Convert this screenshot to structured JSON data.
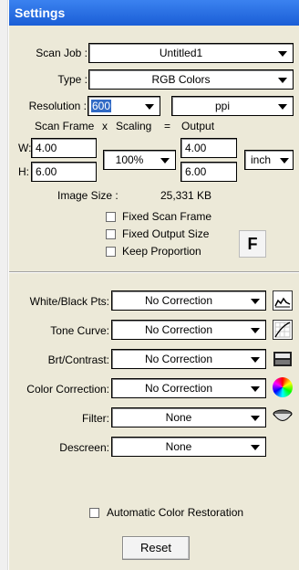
{
  "window": {
    "title": "Settings"
  },
  "scan_job": {
    "label": "Scan Job :",
    "value": "Untitled1"
  },
  "type": {
    "label": "Type :",
    "value": "RGB Colors"
  },
  "resolution": {
    "label": "Resolution :",
    "value": "600",
    "unit": "ppi"
  },
  "frame": {
    "h_scan": "Scan Frame",
    "h_x": "x",
    "h_scaling": "Scaling",
    "h_eq": "=",
    "h_output": "Output",
    "w_label": "W:",
    "h_label": "H:",
    "w_scan": "4.00",
    "h_scan_val": "6.00",
    "scaling": "100%",
    "w_out": "4.00",
    "h_out": "6.00",
    "unit": "inch"
  },
  "image_size": {
    "label": "Image Size :",
    "value": "25,331 KB"
  },
  "options": {
    "fixed_scan_frame": "Fixed Scan Frame",
    "fixed_output_size": "Fixed Output Size",
    "keep_proportion": "Keep Proportion",
    "f_button": "F"
  },
  "corrections": {
    "white_black": {
      "label": "White/Black Pts:",
      "value": "No Correction",
      "icon": "histogram-icon"
    },
    "tone_curve": {
      "label": "Tone Curve:",
      "value": "No Correction",
      "icon": "curve-icon"
    },
    "brt_contrast": {
      "label": "Brt/Contrast:",
      "value": "No Correction",
      "icon": "brightness-icon"
    },
    "color_correction": {
      "label": "Color Correction:",
      "value": "No Correction",
      "icon": "color-wheel-icon"
    },
    "filter": {
      "label": "Filter:",
      "value": "None",
      "icon": "filter-icon"
    },
    "descreen": {
      "label": "Descreen:",
      "value": "None"
    }
  },
  "auto_color": {
    "label": "Automatic Color Restoration"
  },
  "reset": {
    "label": "Reset"
  }
}
